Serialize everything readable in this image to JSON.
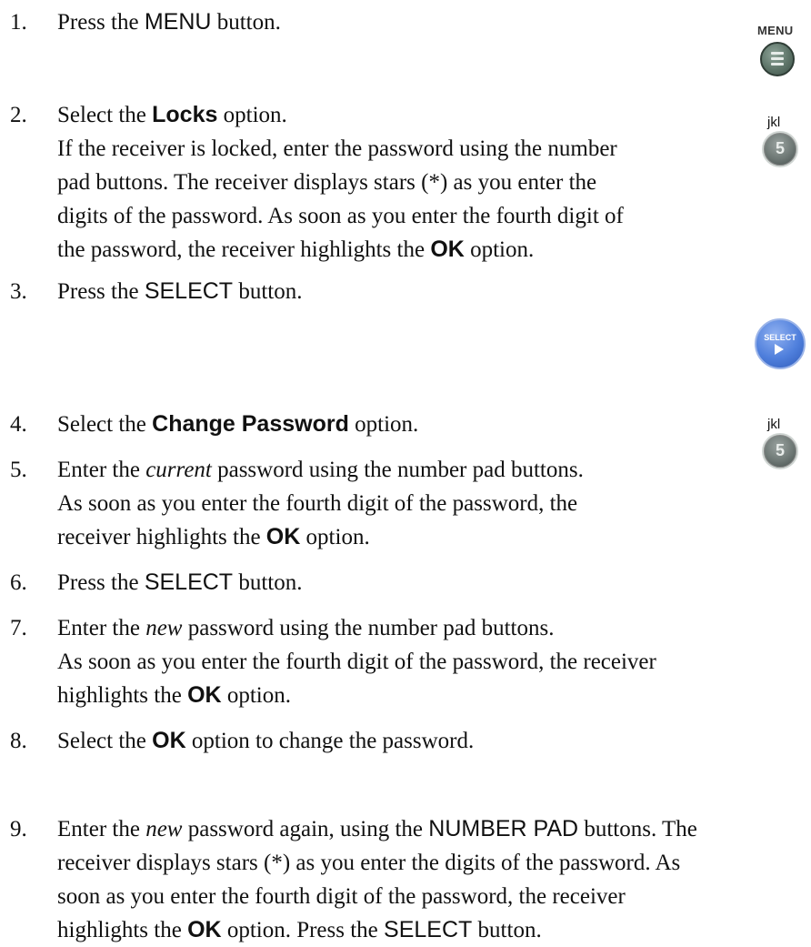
{
  "steps": [
    {
      "num": "1.",
      "a": "Press the ",
      "b": "MENU",
      "c": " button."
    },
    {
      "num": "2.",
      "a": "Select the ",
      "b": "Locks",
      "c": " option.",
      "l2": "If the receiver is locked, enter the password using the number",
      "l3": "pad buttons. The receiver displays stars (*) as you enter the",
      "l4": "digits of the password. As soon as you enter the fourth digit of",
      "l5a": "the password, the receiver highlights the ",
      "l5b": "OK",
      "l5c": " option."
    },
    {
      "num": "3.",
      "a": "Press the ",
      "b": "SELECT",
      "c": " button."
    },
    {
      "num": "4.",
      "a": "Select the ",
      "b": "Change Password",
      "c": " option."
    },
    {
      "num": "5.",
      "a": "Enter the ",
      "b": "current",
      "c": " password using the number pad buttons.",
      "l2": "As soon as you enter the fourth digit of the password, the",
      "l3a": "receiver highlights the ",
      "l3b": "OK",
      "l3c": " option."
    },
    {
      "num": "6.",
      "a": "Press the ",
      "b": "SELECT",
      "c": " button."
    },
    {
      "num": "7.",
      "a": "Enter the ",
      "b": "new",
      "c": " password using the number pad buttons.",
      "l2": "As soon as you enter the fourth digit of the password, the receiver",
      "l3a": "highlights the ",
      "l3b": "OK",
      "l3c": " option."
    },
    {
      "num": "8.",
      "a": "Select the ",
      "b": "OK",
      "c": " option to change the password."
    },
    {
      "num": "9.",
      "a": "Enter the ",
      "b": "new",
      "c": " password again, using the ",
      "d": "NUMBER PAD",
      "e": " buttons. The",
      "l2": "receiver displays stars (*) as you enter the digits of the password. As",
      "l3": "soon as you enter the fourth digit of the password, the receiver",
      "l4a": "highlights the ",
      "l4b": "OK",
      "l4c": " option. Press the ",
      "l4d": "SELECT",
      "l4e": " button."
    }
  ],
  "icons": {
    "menu_caption": "MENU",
    "jkl_caption": "jkl",
    "digit": "5",
    "select_caption": "SELECT"
  }
}
